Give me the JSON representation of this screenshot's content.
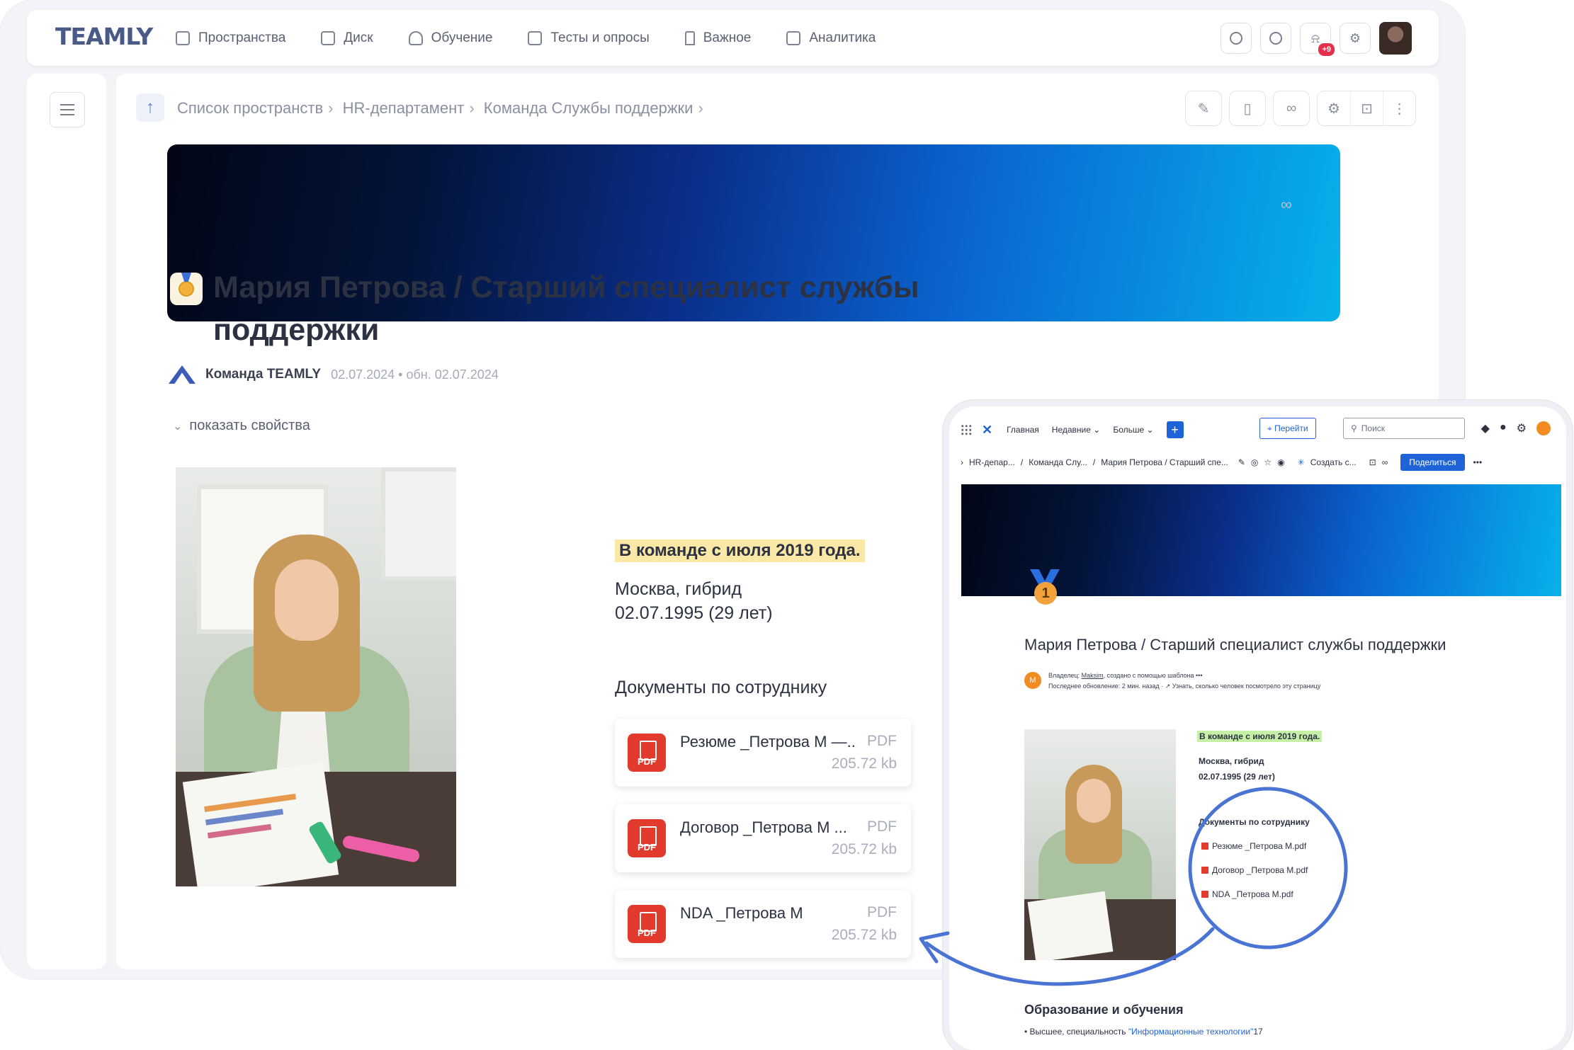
{
  "main": {
    "logo": "TEAMLY",
    "nav": [
      {
        "label": "Пространства",
        "icon": "spaces-icon"
      },
      {
        "label": "Диск",
        "icon": "folder-icon"
      },
      {
        "label": "Обучение",
        "icon": "graduation-cap-icon"
      },
      {
        "label": "Тесты и опросы",
        "icon": "checklist-icon"
      },
      {
        "label": "Важное",
        "icon": "bookmark-icon"
      },
      {
        "label": "Аналитика",
        "icon": "chart-icon"
      }
    ],
    "notifications_badge": "+9",
    "breadcrumb": [
      "Список пространств",
      "HR-департамент",
      "Команда Службы поддержки"
    ],
    "page": {
      "title_line1": "Мария Петрова / Старший специалист службы",
      "title_line2": "поддержки",
      "author": "Команда TEAMLY",
      "meta": "02.07.2024 • обн. 02.07.2024",
      "show_properties": "показать свойства",
      "since": "В команде с июля 2019 года.",
      "location": "Москва, гибрид",
      "dob": "02.07.1995 (29 лет)",
      "docs_heading": "Документы по сотруднику",
      "docs": [
        {
          "name": "Резюме _Петрова М —...",
          "type": "PDF",
          "size": "205.72 kb"
        },
        {
          "name": "Договор _Петрова М ...",
          "type": "PDF",
          "size": "205.72 kb"
        },
        {
          "name": "NDA _Петрова М",
          "type": "PDF",
          "size": "205.72 kb"
        }
      ]
    }
  },
  "secondary": {
    "nav": {
      "home": "Главная",
      "recent": "Недавние ⌄",
      "more": "Больше ⌄",
      "go": "⌖ Перейти",
      "search": "Поиск"
    },
    "breadcrumb": [
      "HR-депар...",
      "/",
      "Команда Слу...",
      "/",
      "Мария Петрова / Старший спе..."
    ],
    "create": "Создать с...",
    "share": "Поделиться",
    "medal_number": "1",
    "title": "Мария Петрова / Старший специалист службы поддержки",
    "owner_initial": "М",
    "owner_line1_prefix": "Владелец: ",
    "owner_name": "Maksim",
    "owner_line1_suffix": ", создано с помощью шаблона  •••",
    "owner_line2": "Последнее обновление: 2 мин. назад  ·  ↗ Узнать, сколько человек посмотрело эту страницу",
    "since": "В команде с июля 2019 года.",
    "location": "Москва, гибрид",
    "dob": "02.07.1995 (29 лет)",
    "docs_heading": "Документы по сотруднику",
    "docs": [
      "Резюме _Петрова М.pdf",
      "Договор _Петрова М.pdf",
      "NDA _Петрова М.pdf"
    ],
    "edu_heading": "Образование и обучения",
    "edu_item_prefix": "• Высшее, специальность ",
    "edu_item_quote": "\"Информационные технологии\"",
    "edu_item_suffix": "17"
  },
  "colors": {
    "accent": "#1e63d8",
    "circle": "#4a74d4",
    "highlight_main": "#fbe7a6",
    "highlight_secondary": "#c6f0a6",
    "pdf": "#e23b2e"
  }
}
